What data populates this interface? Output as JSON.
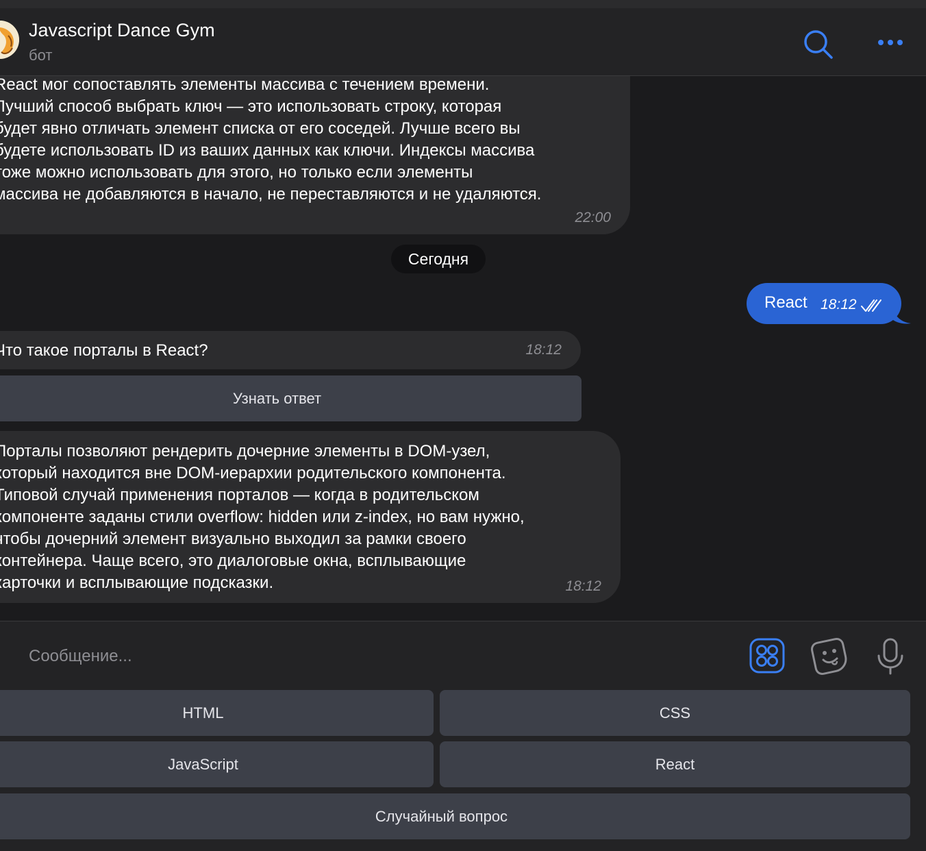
{
  "header": {
    "title": "Javascript Dance Gym",
    "subtitle": "бот"
  },
  "messages": [
    {
      "text": "React мог сопоставлять элементы массива с течением времени.\nЛучший способ выбрать ключ — это использовать строку, которая\nбудет явно отличать элемент списка от его соседей. Лучше всего вы\nбудете использовать ID из ваших данных как ключи. Индексы массива\nтоже можно использовать для этого, но только если элементы\nмассива не добавляются в начало, не переставляются и не удаляются.",
      "time": "22:00"
    },
    {
      "text": "Что такое порталы в React?",
      "time": "18:12",
      "button": "Узнать ответ"
    },
    {
      "text": "Порталы позволяют рендерить дочерние элементы в DOM-узел,\nкоторый находится вне DOM-иерархии родительского компонента.\nТиповой случай применения порталов — когда в родительском\nкомпоненте заданы стили overflow: hidden или z-index, но вам нужно,\nчтобы дочерний элемент визуально выходил за рамки своего\nконтейнера. Чаще всего, это диалоговые окна, всплывающие\nкарточки и всплывающие подсказки.",
      "time": "18:12"
    }
  ],
  "date_separator": "Сегодня",
  "outgoing": {
    "text": "React",
    "time": "18:12",
    "status_icon": "double-check-icon"
  },
  "composer": {
    "placeholder": "Сообщение..."
  },
  "keyboard": {
    "html": "HTML",
    "css": "CSS",
    "javascript": "JavaScript",
    "react": "React",
    "random": "Случайный вопрос"
  },
  "colors": {
    "accent": "#2a64d4",
    "icon_blue": "#3a7ff5",
    "bubble": "#2c2c2e",
    "button": "#3d4049",
    "background": "#1b1b1d"
  }
}
